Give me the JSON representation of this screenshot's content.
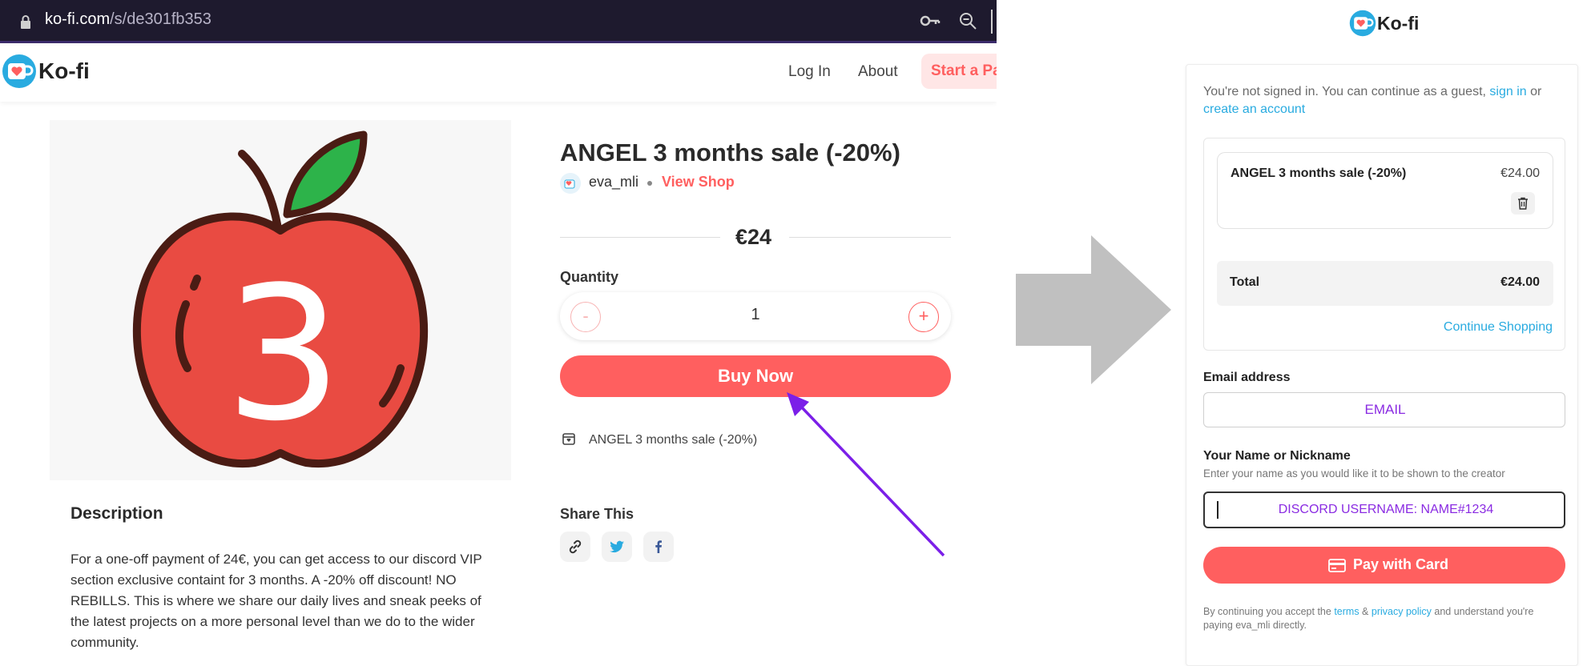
{
  "browser": {
    "url_host": "ko-fi.com",
    "url_path": "/s/de301fb353"
  },
  "site_nav": {
    "logo_text": "Ko-fi",
    "login": "Log In",
    "about": "About",
    "start": "Start a Pa"
  },
  "product": {
    "title": "ANGEL 3 months sale (-20%)",
    "creator": "eva_mli",
    "view_shop": "View Shop",
    "price": "€24",
    "quantity_label": "Quantity",
    "quantity_minus": "-",
    "quantity_value": "1",
    "quantity_plus": "+",
    "buy_button": "Buy Now",
    "included_item": "ANGEL 3 months sale (-20%)",
    "share_title": "Share This",
    "description_title": "Description",
    "description_text": "For a one-off payment of 24€, you can get access to our discord VIP section exclusive containt for 3 months. A -20% off discount! NO REBILLS. This is where we share our daily lives and sneak peeks of the latest projects on a more personal level than we do to the wider community."
  },
  "checkout": {
    "logo_text": "Ko-fi",
    "guest_prefix": "You're not signed in. You can continue as a guest,",
    "sign_in": "sign in",
    "or": "or",
    "create_account": "create an account",
    "cart_item_name": "ANGEL 3 months sale (-20%)",
    "cart_item_price": "€24.00",
    "total_label": "Total",
    "total_value": "€24.00",
    "continue_shopping": "Continue Shopping",
    "email_label": "Email address",
    "email_annotation": "EMAIL",
    "name_label": "Your Name or Nickname",
    "name_help": "Enter your name as you would like it to be shown to the creator",
    "name_annotation": "DISCORD USERNAME: NAME#1234",
    "pay_button": "Pay with Card",
    "legal_prefix": "By continuing you accept the",
    "terms": "terms",
    "amp": "&",
    "privacy": "privacy policy",
    "legal_suffix": "and understand you're paying eva_mli directly."
  },
  "colors": {
    "accent": "#ff5f5f",
    "link": "#29abe0",
    "annotation": "#8a2be2",
    "arrow_gray": "#c0c0c0"
  },
  "icons": [
    "lock-icon",
    "key-icon",
    "zoom-out-icon",
    "kofi-cup-icon",
    "shop-item-icon",
    "link-icon",
    "twitter-icon",
    "facebook-icon",
    "trash-icon",
    "credit-card-icon",
    "right-arrow-icon",
    "annotation-arrow-icon"
  ]
}
